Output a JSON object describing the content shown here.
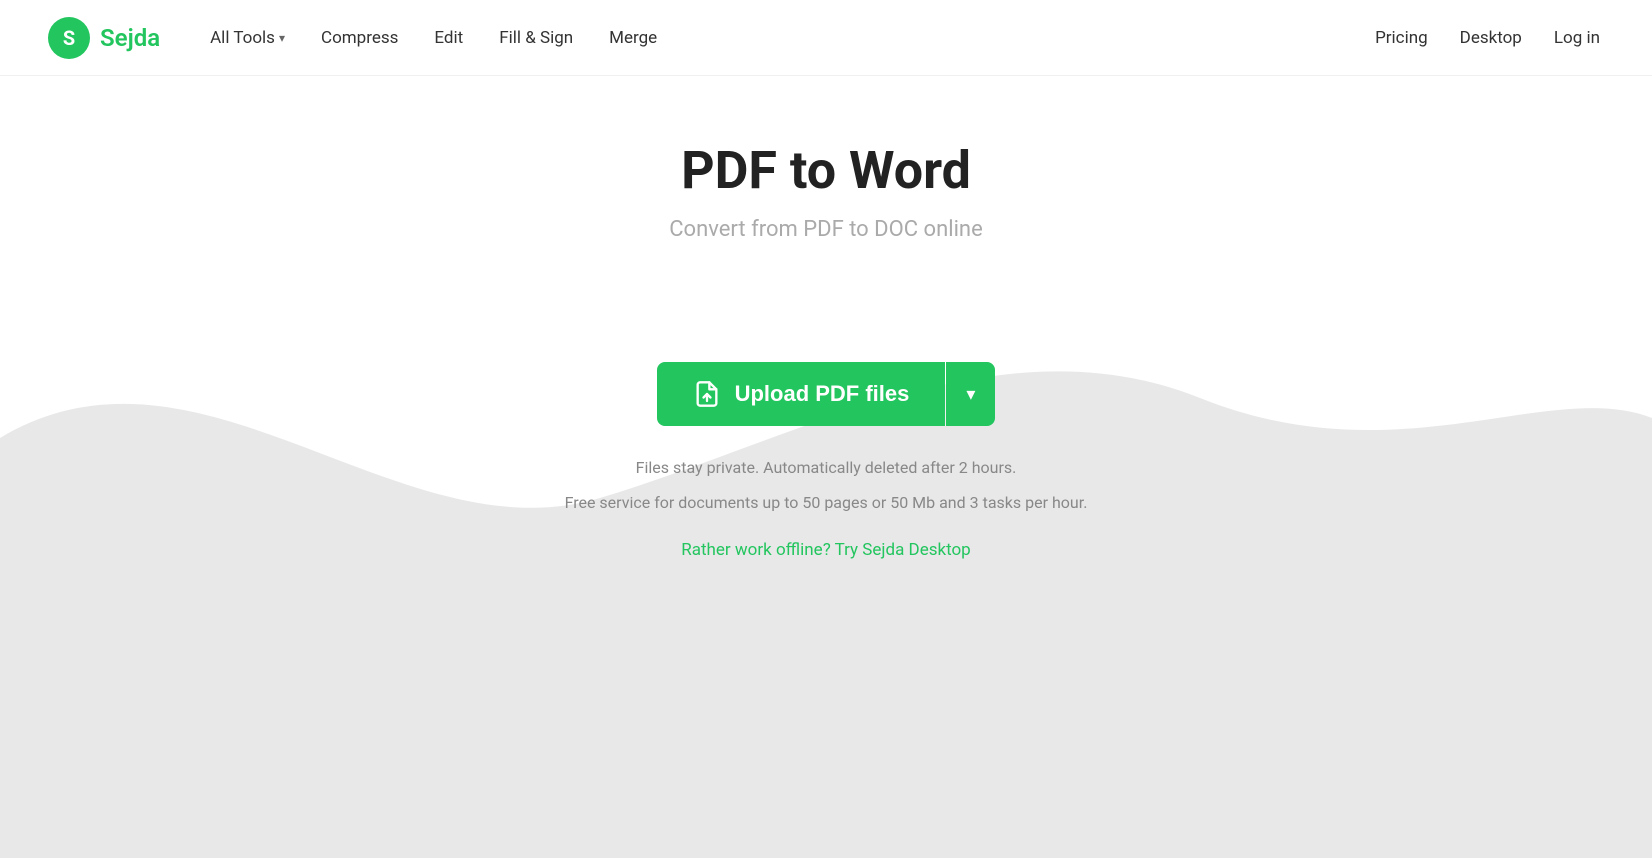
{
  "logo": {
    "initial": "S",
    "name": "Sejda"
  },
  "nav": {
    "items": [
      {
        "label": "All Tools",
        "has_dropdown": true
      },
      {
        "label": "Compress",
        "has_dropdown": false
      },
      {
        "label": "Edit",
        "has_dropdown": false
      },
      {
        "label": "Fill & Sign",
        "has_dropdown": false
      },
      {
        "label": "Merge",
        "has_dropdown": false
      }
    ]
  },
  "header_right": {
    "pricing": "Pricing",
    "desktop": "Desktop",
    "login": "Log in"
  },
  "hero": {
    "title": "PDF to Word",
    "subtitle": "Convert from PDF to DOC online"
  },
  "upload": {
    "button_label": "Upload PDF files",
    "dropdown_arrow": "▾"
  },
  "privacy": {
    "line1": "Files stay private. Automatically deleted after 2 hours.",
    "line2": "Free service for documents up to 50 pages or 50 Mb and 3 tasks per hour."
  },
  "offline_link": {
    "text": "Rather work offline? Try Sejda Desktop"
  },
  "colors": {
    "brand_green": "#22c55e",
    "text_dark": "#222222",
    "text_gray": "#aaaaaa",
    "bg_wave": "#ebebeb"
  }
}
